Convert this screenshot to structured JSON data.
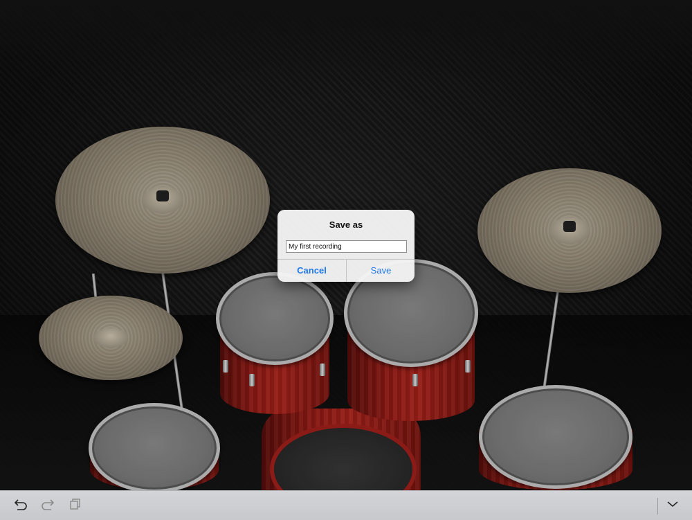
{
  "app": {
    "scene": "drum-kit"
  },
  "dialog": {
    "title": "Save as",
    "input_value": "My first recording",
    "cancel_label": "Cancel",
    "save_label": "Save",
    "accent_color": "#1f77e8"
  },
  "toolbar": {
    "icons": [
      "undo-icon",
      "redo-icon",
      "copy-icon",
      "chevron-down-icon"
    ]
  }
}
